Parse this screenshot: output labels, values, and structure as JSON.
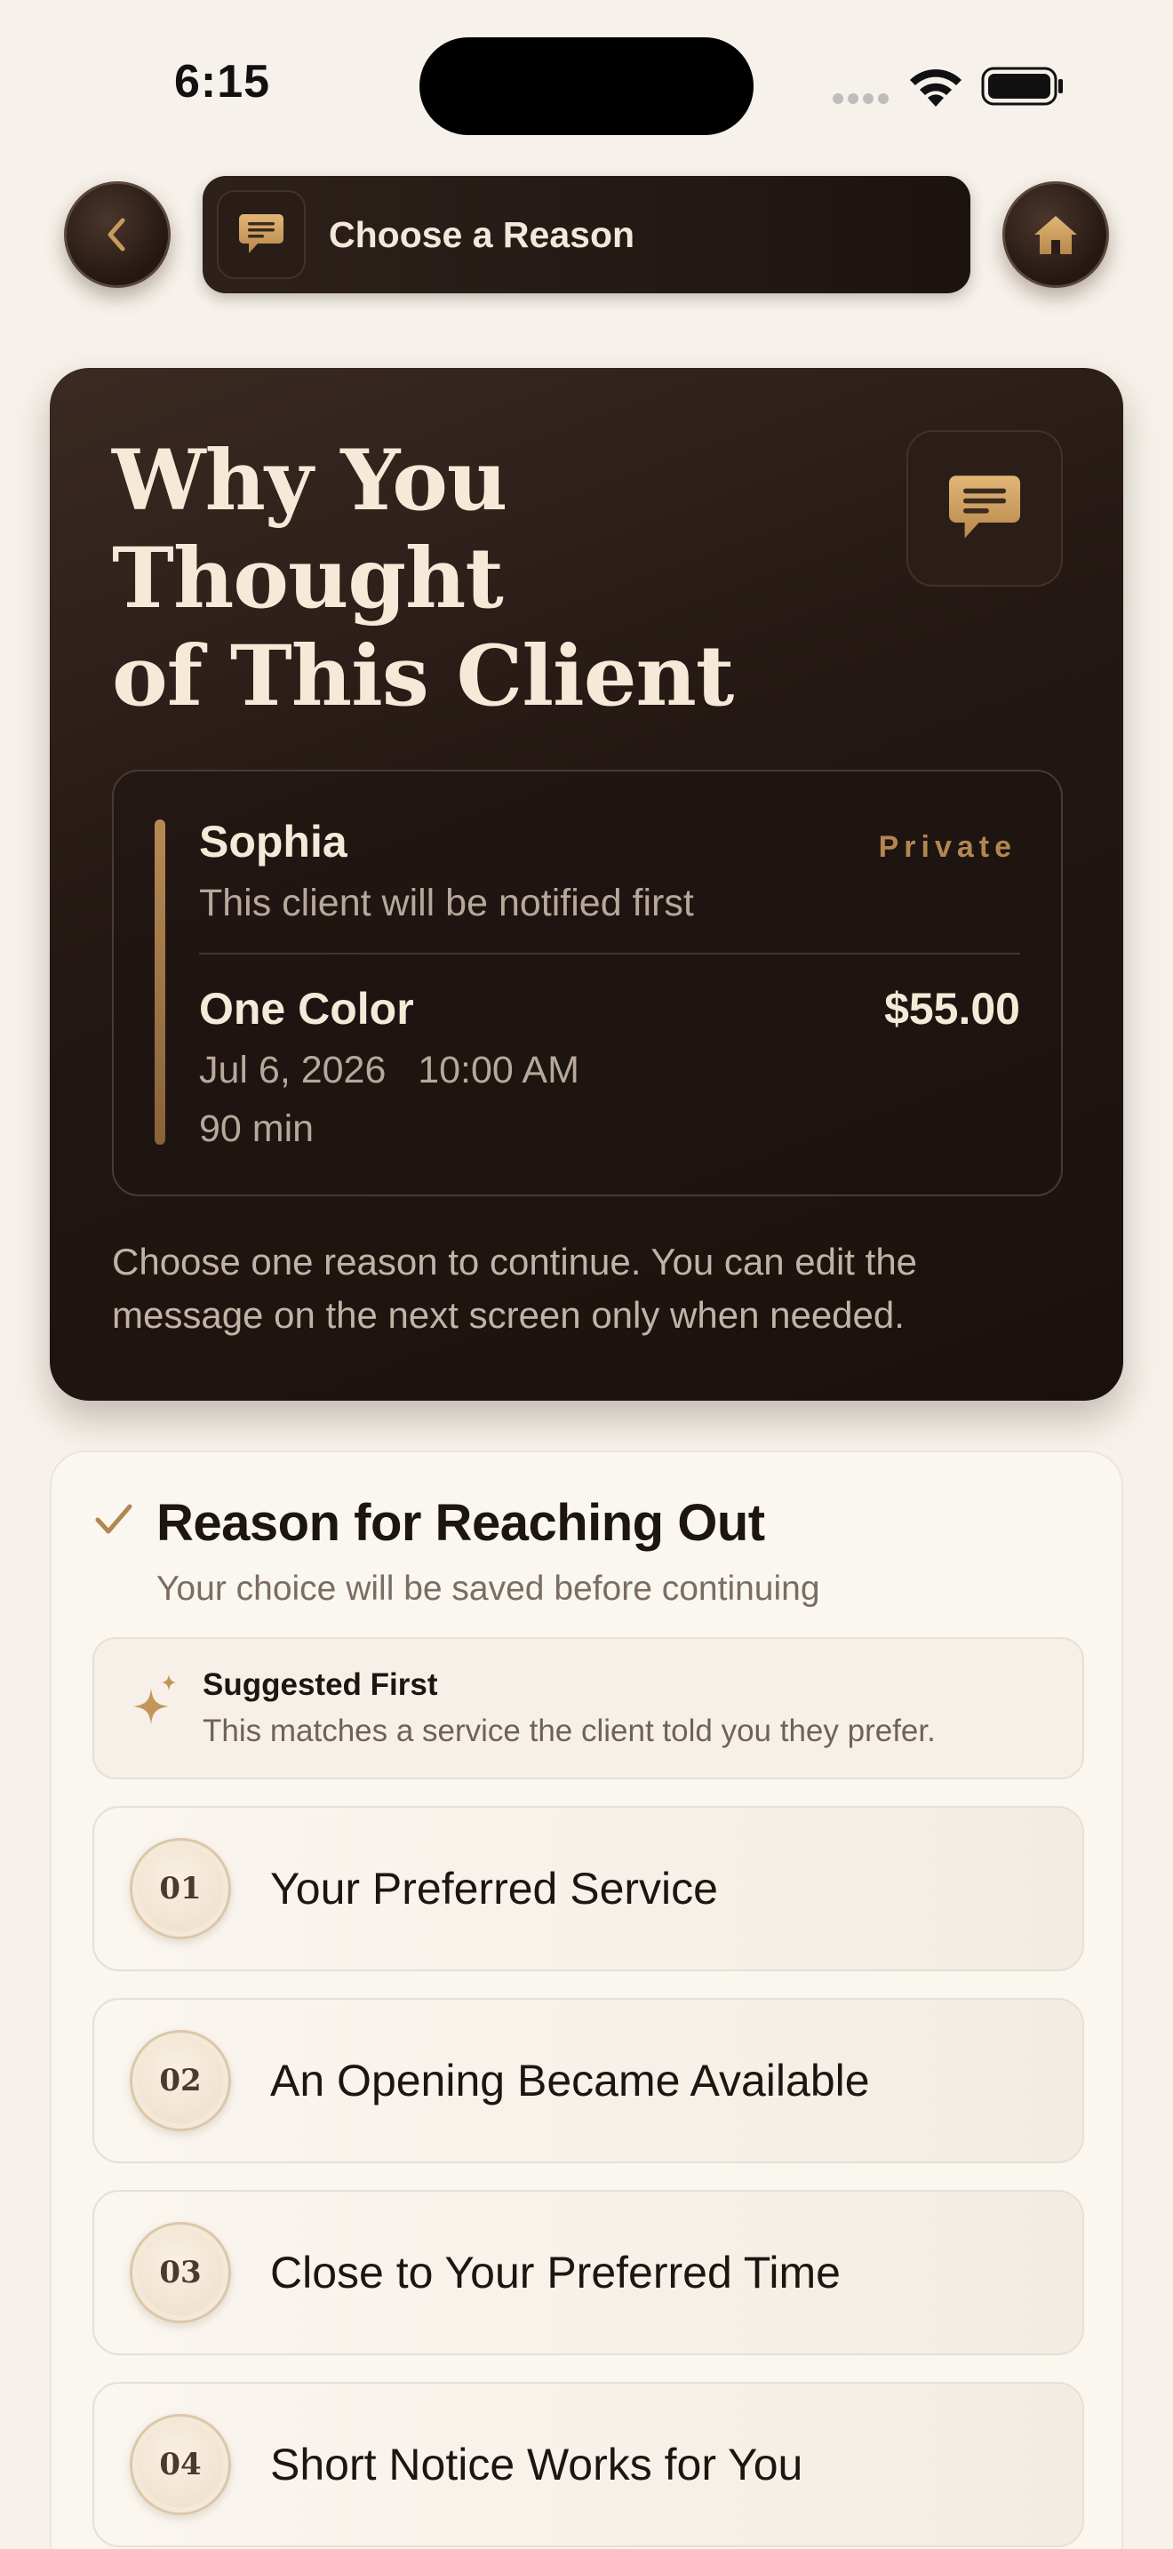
{
  "status_bar": {
    "time": "6:15"
  },
  "nav": {
    "title": "Choose a Reason"
  },
  "hero": {
    "title_lines": [
      "Why You",
      "Thought",
      "of This Client"
    ],
    "client": {
      "name": "Sophia",
      "badge": "Private",
      "note": "This client will be notified first"
    },
    "booking": {
      "service": "One Color",
      "price": "$55.00",
      "date_time": "Jul 6, 2026   10:00 AM",
      "duration": "90 min"
    },
    "instructions": "Choose one reason to continue. You can edit the message on the next screen only when needed."
  },
  "reason_section": {
    "title": "Reason for Reaching Out",
    "subtitle": "Your choice will be saved before continuing",
    "suggestion": {
      "title": "Suggested First",
      "text": "This matches a service the client told you they prefer."
    },
    "options": [
      {
        "number": "01",
        "label": "Your Preferred Service"
      },
      {
        "number": "02",
        "label": "An Opening Became Available"
      },
      {
        "number": "03",
        "label": "Close to Your Preferred Time"
      },
      {
        "number": "04",
        "label": "Short Notice Works for You"
      }
    ]
  },
  "colors": {
    "accent_gold": "#b28650",
    "dark_surface": "#231713",
    "page_background": "#f6f1ea"
  },
  "icons": [
    "chevron-left-icon",
    "message-icon",
    "home-icon",
    "check-icon",
    "sparkle-icon",
    "wifi-icon",
    "battery-icon",
    "signal-icon"
  ]
}
